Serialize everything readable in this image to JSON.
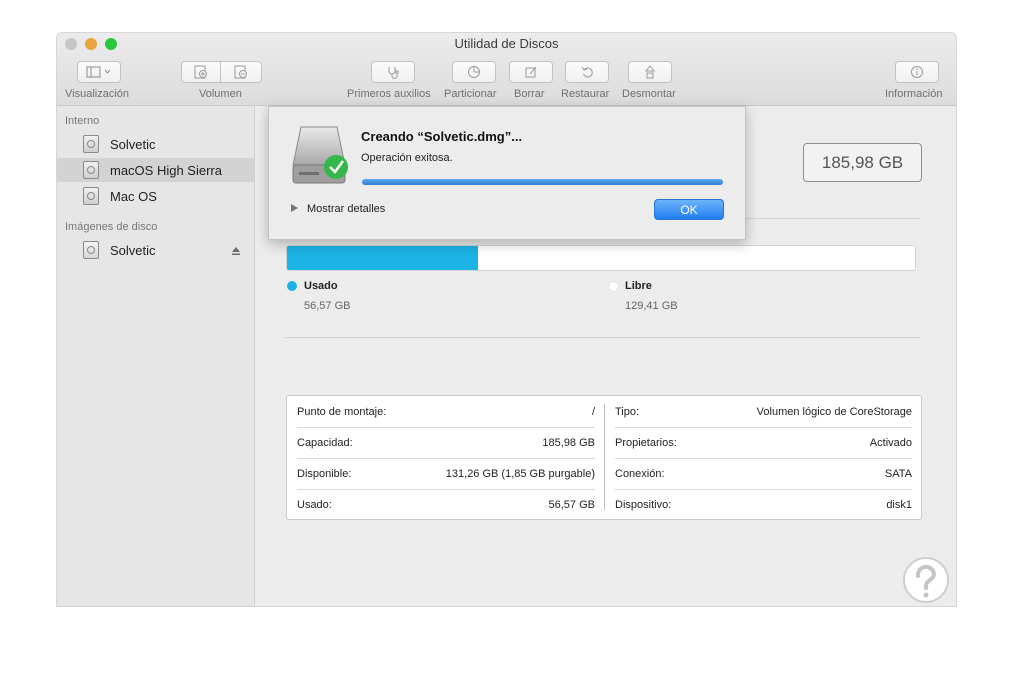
{
  "window": {
    "title": "Utilidad de Discos",
    "traffic_colors": [
      "#c6c6c6",
      "#e9a43b",
      "#2bc73c"
    ]
  },
  "toolbar": {
    "visualizacion": "Visualización",
    "volumen": "Volumen",
    "primeros_auxilios": "Primeros auxilios",
    "particionar": "Particionar",
    "borrar": "Borrar",
    "restaurar": "Restaurar",
    "desmontar": "Desmontar",
    "informacion": "Información"
  },
  "sidebar": {
    "interno_header": "Interno",
    "internal_items": [
      {
        "label": "Solvetic"
      },
      {
        "label": "macOS High Sierra"
      },
      {
        "label": "Mac OS"
      }
    ],
    "images_header": "Imágenes de disco",
    "image_items": [
      {
        "label": "Solvetic"
      }
    ]
  },
  "main": {
    "capacity": "185,98 GB",
    "used_fraction": 0.304,
    "used_color": "#1db3e6",
    "legend": {
      "used_name": "Usado",
      "used_value": "56,57 GB",
      "free_name": "Libre",
      "free_value": "129,41 GB"
    },
    "info": {
      "left": [
        {
          "key": "Punto de montaje:",
          "value": "/"
        },
        {
          "key": "Capacidad:",
          "value": "185,98 GB"
        },
        {
          "key": "Disponible:",
          "value": "131,26 GB (1,85 GB purgable)"
        },
        {
          "key": "Usado:",
          "value": "56,57 GB"
        }
      ],
      "right": [
        {
          "key": "Tipo:",
          "value": "Volumen lógico de CoreStorage"
        },
        {
          "key": "Propietarios:",
          "value": "Activado"
        },
        {
          "key": "Conexión:",
          "value": "SATA"
        },
        {
          "key": "Dispositivo:",
          "value": "disk1"
        }
      ]
    }
  },
  "dialog": {
    "title": "Creando “Solvetic.dmg”...",
    "message": "Operación exitosa.",
    "progress": 1.0,
    "details": "Mostrar detalles",
    "ok": "OK"
  }
}
